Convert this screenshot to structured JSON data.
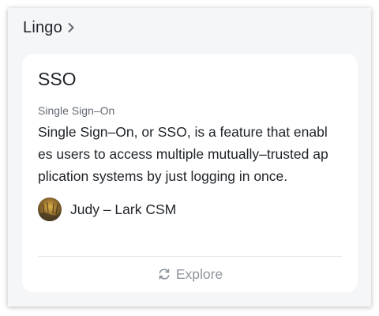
{
  "header": {
    "title": "Lingo",
    "chevron_icon": "chevron-right-icon"
  },
  "entry": {
    "term": "SSO",
    "full_name": "Single Sign–On",
    "definition": "Single Sign–On, or SSO, is a feature that enables users to access multiple mutually–trusted application systems by just logging in once."
  },
  "author": {
    "name": "Judy – Lark CSM",
    "avatar_icon": "avatar"
  },
  "footer": {
    "explore_label": "Explore",
    "explore_icon": "refresh-icon"
  },
  "colors": {
    "background": "#f5f6f7",
    "card": "#ffffff",
    "text_primary": "#1f2329",
    "text_secondary": "#646a73",
    "text_muted": "#8f959e",
    "divider": "#e3e5e8"
  }
}
